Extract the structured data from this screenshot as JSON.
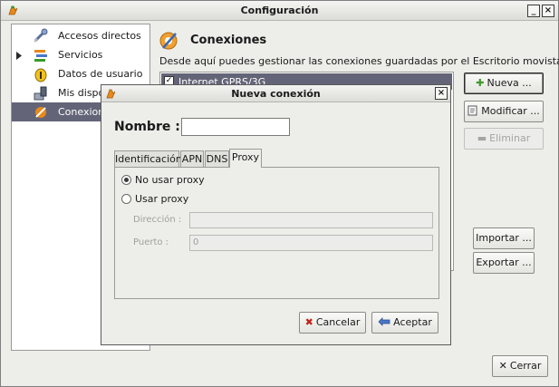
{
  "window": {
    "title": "Configuración",
    "minimize_label": "_",
    "close_label": "×"
  },
  "sidebar": {
    "items": [
      {
        "label": "Accesos directos",
        "icon": "shortcuts-icon"
      },
      {
        "label": "Servicios",
        "icon": "services-icon",
        "expandable": true
      },
      {
        "label": "Datos de usuario",
        "icon": "user-data-icon"
      },
      {
        "label": "Mis dispos",
        "icon": "devices-icon"
      },
      {
        "label": "Conexion",
        "icon": "connections-icon",
        "selected": true
      }
    ]
  },
  "main": {
    "title": "Conexiones",
    "description": "Desde aquí puedes gestionar las conexiones guardadas por el Escritorio movistar.",
    "connections": [
      {
        "label": "Internet GPRS/3G",
        "checked": true
      }
    ],
    "buttons": {
      "new": "Nueva ...",
      "modify": "Modificar ...",
      "delete": "Eliminar",
      "import": "Importar ...",
      "export": "Exportar ...",
      "close": "Cerrar"
    }
  },
  "dialog": {
    "title": "Nueva conexión",
    "close_label": "×",
    "name_label": "Nombre :",
    "name_value": "",
    "tabs": [
      "Identificación",
      "APN",
      "DNS",
      "Proxy"
    ],
    "active_tab": "Proxy",
    "proxy": {
      "no_proxy_label": "No usar proxy",
      "use_proxy_label": "Usar proxy",
      "selected": "No usar proxy",
      "address_label": "Dirección :",
      "address_value": "",
      "port_label": "Puerto :",
      "port_value": "0"
    },
    "buttons": {
      "cancel": "Cancelar",
      "accept": "Aceptar"
    }
  },
  "colors": {
    "selection": "#646478",
    "window_bg": "#ededea",
    "accent_orange": "#e8891a",
    "add_green": "#3c9a2a",
    "cancel_red": "#c0241a"
  }
}
